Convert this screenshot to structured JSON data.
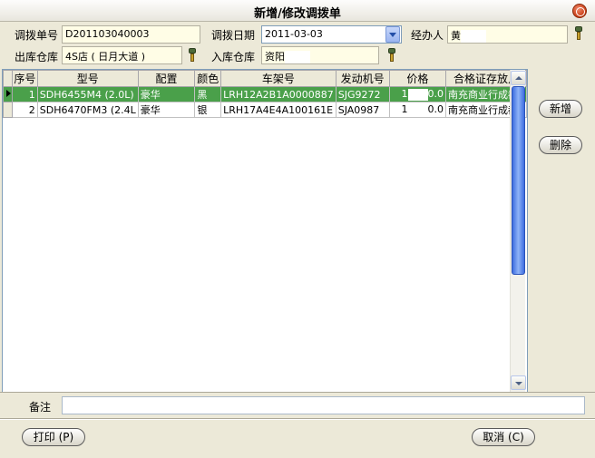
{
  "window": {
    "title": "新增/修改调拨单"
  },
  "form": {
    "order_no_label": "调拨单号",
    "order_no": "D201103040003",
    "date_label": "调拨日期",
    "date": "2011-03-03",
    "handler_label": "经办人",
    "handler": "黄",
    "out_wh_label": "出库仓库",
    "out_wh": "4S店 ( 日月大道 )",
    "in_wh_label": "入库仓库",
    "in_wh": "资阳"
  },
  "grid": {
    "headers": [
      "序号",
      "型号",
      "配置",
      "颜色",
      "车架号",
      "发动机号",
      "价格",
      "合格证存放点"
    ],
    "rows": [
      {
        "seq": "1",
        "model": "SDH6455M4 (2.0L)",
        "config": "豪华",
        "color": "黑",
        "vin": "LRH12A2B1A0000887",
        "engine": "SJG9272",
        "price_head": "1",
        "price_tail": "0.0",
        "cert": "南充商业行成都"
      },
      {
        "seq": "2",
        "model": "SDH6470FM3 (2.4L",
        "config": "豪华",
        "color": "银",
        "vin": "LRH17A4E4A100161E",
        "engine": "SJA0987",
        "price_head": "1",
        "price_tail": "0.0",
        "cert": "南充商业行成都"
      }
    ]
  },
  "side_buttons": {
    "add": "新增",
    "delete": "删除"
  },
  "remark": {
    "label": "备注",
    "value": ""
  },
  "footer": {
    "print": "打印 (P)",
    "cancel": "取消 (C)"
  }
}
